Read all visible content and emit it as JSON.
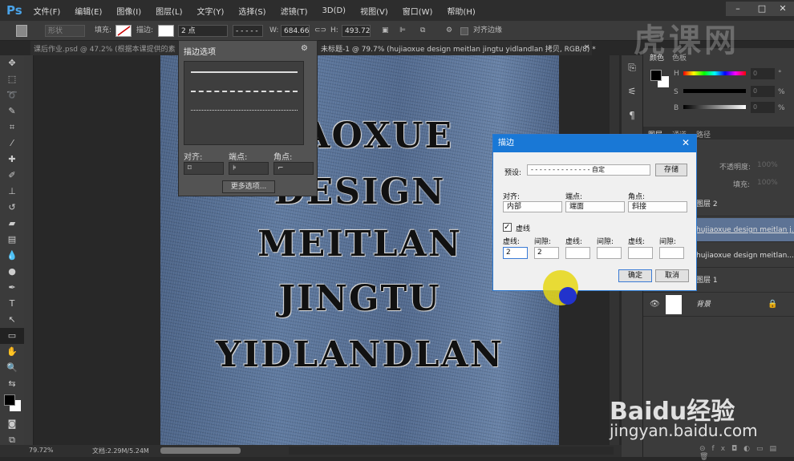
{
  "app": {
    "logo": "Ps",
    "menu": [
      "文件(F)",
      "编辑(E)",
      "图像(I)",
      "图层(L)",
      "文字(Y)",
      "选择(S)",
      "滤镜(T)",
      "3D(D)",
      "视图(V)",
      "窗口(W)",
      "帮助(H)"
    ],
    "window_controls": [
      "–",
      "□",
      "✕"
    ]
  },
  "options": {
    "mode": "形状",
    "fill_label": "填充:",
    "stroke_label": "描边:",
    "stroke_width": "2 点",
    "w_label": "W:",
    "w_value": "684.66",
    "h_label": "H:",
    "h_value": "493.72",
    "align_edges": "对齐边缘"
  },
  "tabs": [
    "课后作业.psd @ 47.2% (根据本课提供的素",
    "未标题-1 @ 79.7% (hujiaoxue design meitlan jingtu yidlandlan 拷贝, RGB/8) *"
  ],
  "tab_close": "×",
  "canvas": {
    "words": [
      "JIAOXUE",
      "DESIGN",
      "MEITLAN",
      "JINGTU",
      "YIDLANDLAN"
    ]
  },
  "stroke_popup": {
    "title": "描边选项",
    "align_label": "对齐:",
    "caps_label": "端点:",
    "corners_label": "角点:",
    "more_button": "更多选项..."
  },
  "dialog": {
    "title": "描边",
    "preset_label": "预设:",
    "preset_value": "- - - - - - - - - - - - - - 自定",
    "save_button": "存储",
    "align_label": "对齐:",
    "align_value": "内部",
    "caps_label": "端点:",
    "caps_value": "端面",
    "corners_label": "角点:",
    "corners_value": "斜接",
    "dashed_label": "虚线",
    "dashed_checked": true,
    "fields": [
      {
        "label": "虚线:",
        "value": "2"
      },
      {
        "label": "间隙:",
        "value": "2"
      },
      {
        "label": "虚线:",
        "value": ""
      },
      {
        "label": "间隙:",
        "value": ""
      },
      {
        "label": "虚线:",
        "value": ""
      },
      {
        "label": "间隙:",
        "value": ""
      }
    ],
    "ok_button": "确定",
    "cancel_button": "取消",
    "close": "✕"
  },
  "color_panel": {
    "tabs": [
      "颜色",
      "色板"
    ],
    "h": "H",
    "s": "S",
    "b": "B",
    "h_value": "0",
    "s_value": "0",
    "b_value": "0",
    "h_unit": "°",
    "s_unit": "%",
    "b_unit": "%"
  },
  "layers_panel": {
    "tabs": [
      "图层",
      "通道",
      "路径"
    ],
    "opacity_label": "不透明度:",
    "opacity_value": "100%",
    "fill_label": "填充:",
    "fill_value": "100%",
    "layers": [
      "图层 2",
      "hujiaoxue design meitlan j...",
      "hujiaoxue design meitlan...",
      "图层 1",
      "背景"
    ]
  },
  "status": {
    "zoom": "79.72%",
    "doc": "文档:2.29M/5.24M"
  },
  "watermarks": {
    "top": "虎课网",
    "baidu": "Baidu经验",
    "baidu_url": "jingyan.baidu.com"
  }
}
